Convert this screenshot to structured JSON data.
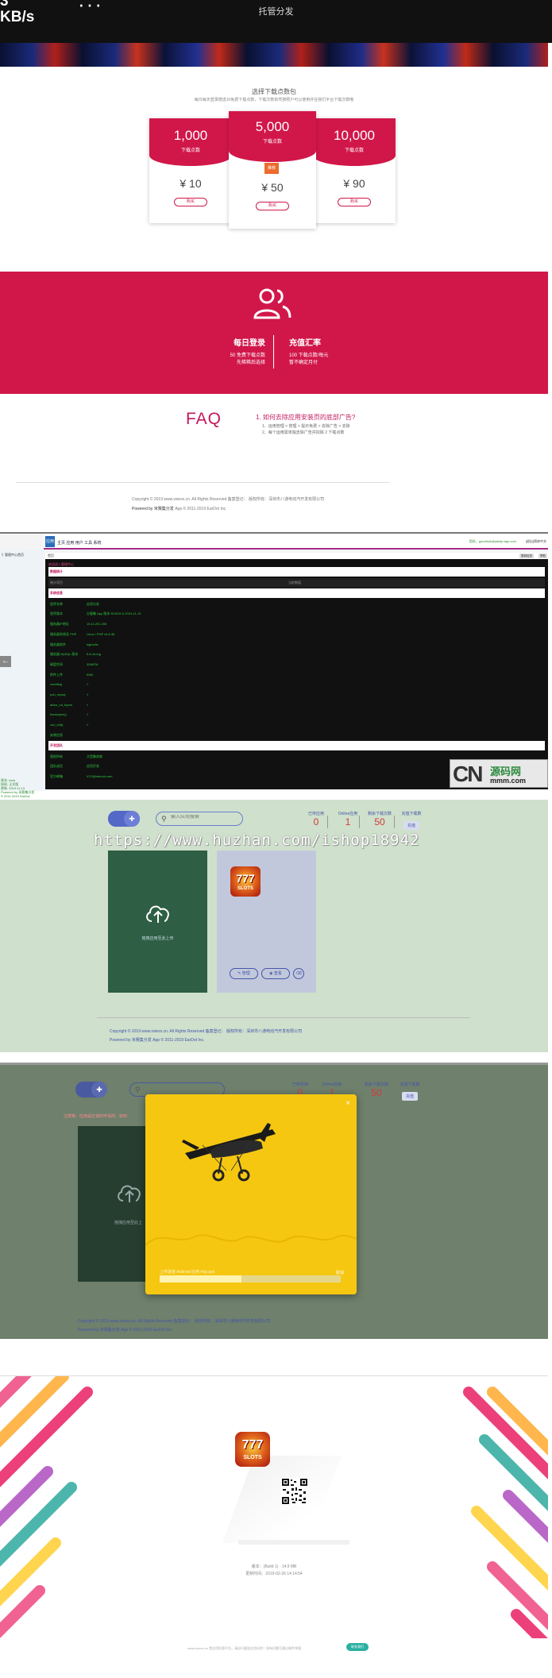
{
  "status_bar": {
    "speed_value": "3",
    "speed_unit": "KB/s",
    "dots": "···",
    "title": "托管分发"
  },
  "plans": {
    "title": "选择下载点数包",
    "subtitle": "每日每天登录赠送10免费下载点数，下载次数依然按照户可以使用并在我们平台下载次数哦",
    "items": [
      {
        "count": "1,000",
        "unit": "下载点数",
        "price": "¥ 10",
        "button": "购买"
      },
      {
        "count": "5,000",
        "unit": "下载点数",
        "price": "¥ 50",
        "button": "购买",
        "tag": "推荐"
      },
      {
        "count": "10,000",
        "unit": "下载点数",
        "price": "¥ 90",
        "button": "购买"
      }
    ]
  },
  "band": {
    "left_title": "每日登录",
    "left_line1": "50 免费下载点数",
    "left_line2": "先稀稀后选择",
    "right_title": "充值汇率",
    "right_line1": "100 下载点数/每元",
    "right_line2": "暂不确定月付"
  },
  "faq": {
    "heading": "FAQ",
    "question": "1. 如何去除应用安装页的底部广告?",
    "answer1": "1、运用管理 > 管理 > 提示免费 > 去除广告 > 去除",
    "answer2": "2、每个运用需单独去除广告并扣除 2 下载点数"
  },
  "footer1": {
    "copyright": "Copyright © 2019 www.xxiexx.cn. All Rights Reserved    备案登记：  版权所有：深圳市八通电动汽开发有限公司",
    "powered_prefix": "Powered by",
    "powered_name": "米赛集分发",
    "powered_suffix": "App © 2011-2019 EarDot Inc."
  },
  "admin": {
    "logo": "应用",
    "nav": "主页  应用  用户  工具  系统",
    "user": "您好，goodlook@ydiolp.app.com",
    "exit": "[退出]",
    "lang": "简体中文",
    "sidebar_home": "》管理中心首页",
    "sidebar_info": [
      "版本: beta",
      "授权: 正式版",
      "更新: 2019.11.13",
      "Powered by 米赛集分发",
      "© 2011-2019 EarDot"
    ],
    "crumb": "首页",
    "crumb_buttons": [
      "更新检查",
      "帮助"
    ],
    "heading": "欢迎进入管理中心",
    "rows": [
      {
        "type": "header",
        "k": "数据统计",
        "v": ""
      },
      {
        "type": "head2",
        "k": "统计项目",
        "v": "当前数值"
      },
      {
        "type": "header",
        "k": "系统信息",
        "v": ""
      },
      {
        "k": "程序名称",
        "v": "应用分发"
      },
      {
        "k": "程序版本",
        "v": "分量集 App 版本 R/2019 & 2019-11-13"
      },
      {
        "k": "服务器IP地址",
        "v": "10.11.201.205"
      },
      {
        "k": "服务器系统及 PHP",
        "v": "Linux / PHP v5.6.36"
      },
      {
        "k": "服务器软件",
        "v": "nginx/lin"
      },
      {
        "k": "服务器 MySQL 版本",
        "v": "5.6.44-log"
      },
      {
        "k": "磁盘空间",
        "v": "32667M"
      },
      {
        "k": "附件上传",
        "v": "50M"
      },
      {
        "k": "rewriting",
        "v": "√"
      },
      {
        "k": "pdo_mysql",
        "v": "√"
      },
      {
        "k": "allow_url_fopen",
        "v": "√"
      },
      {
        "k": "fsockopen()",
        "v": "√"
      },
      {
        "k": "curl_init()",
        "v": "√"
      },
      {
        "k": "安装信息",
        "v": ""
      },
      {
        "type": "header",
        "k": "开发团队",
        "v": ""
      },
      {
        "k": "版权所有",
        "v": "大型集成商"
      },
      {
        "k": "团队成员",
        "v": "应用开发"
      },
      {
        "k": "官方邮箱",
        "v": "XYZ@mbook.com"
      }
    ],
    "watermark_cn": "CN",
    "watermark_name": "源码网",
    "watermark_url": "mmm.com"
  },
  "upload": {
    "search_placeholder": "输入应用搜索",
    "stats": [
      {
        "label": "已传应用",
        "value": "0"
      },
      {
        "label": "Online应用",
        "value": "1"
      },
      {
        "label": "剩余下载次数",
        "value": "50"
      },
      {
        "label": "充值下载数",
        "button": "充值"
      }
    ],
    "url_watermark": "https://www.huzhan.com/ishop18942",
    "upload_text": "拖拽应用至此上传",
    "app_buttons": [
      "管理",
      "查看"
    ],
    "app_icon_big": "777",
    "app_icon_small": "SLOTS",
    "copyright": "Copyright © 2019 www.xxiexx.cn. All Rights Reserved    备案登记：  版权所有：深圳市八通电动汽开发有限公司",
    "powered": "Powered by 米赛集分发 App © 2011-2019 EarDot Inc."
  },
  "modal": {
    "warn": "注意哦：应用是应该的申请商，如何",
    "bg_upload_text": "拖拽应用至此上",
    "close": "×",
    "progress_text": "上传进度 Android 应用 http.apk",
    "progress_label": "取消",
    "progress": 0.45,
    "copyright": "Copyright © 2019 www.xxiexx.cn. All Rights Reserved    备案登记：  版权所有：深圳市八通电动汽开发有限公司",
    "powered": "Powered by 米赛集分发 App © 2011-2019 EarDot Inc."
  },
  "download": {
    "version_line1": "版本：(Build 1)  · 14.9 MB",
    "version_line2": "更新时间：2019-02-26 14:14:54",
    "footer": "www.xxiexx.cn 是应用托管平台，请自行甄别应用风险！如有问题可通过邮件举报",
    "footer_button": "联系我们"
  },
  "colors": {
    "brand_pink": "#d1174a",
    "admin_green": "#2ecc40",
    "link_blue": "#4455aa",
    "modal_yellow": "#f5c711"
  }
}
